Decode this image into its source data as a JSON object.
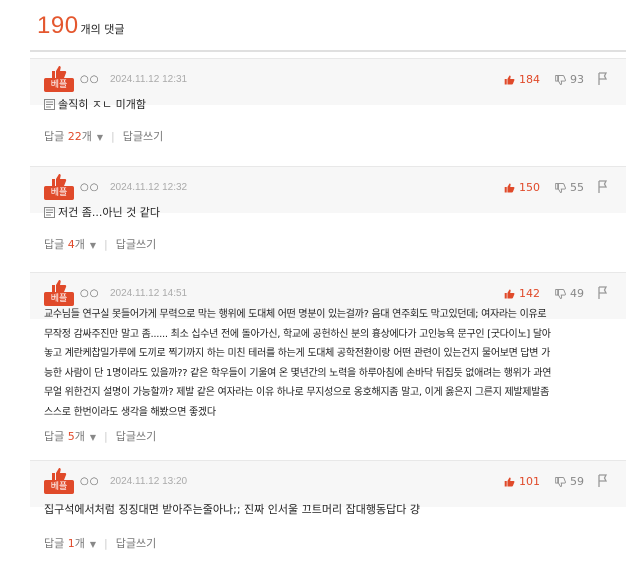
{
  "header": {
    "count": "190",
    "count_label": "개의 댓글"
  },
  "badge_label": "베플",
  "reply_write_label": "답글쓰기",
  "reply_prefix": "답글",
  "reply_suffix": "개",
  "colors": {
    "accent": "#e04a2a",
    "meta_bg": "#f7f7f7"
  },
  "comments": [
    {
      "author": "○○",
      "date": "2024.11.12 12:31",
      "likes": "184",
      "dislikes": "93",
      "text": "솔직히 ㅈㄴ 미개함",
      "has_image_mark": true,
      "reply_count": "22"
    },
    {
      "author": "○○",
      "date": "2024.11.12 12:32",
      "likes": "150",
      "dislikes": "55",
      "text": "저건 좀...아닌 것 같다",
      "has_image_mark": true,
      "reply_count": "4"
    },
    {
      "author": "○○",
      "date": "2024.11.12 14:51",
      "likes": "142",
      "dislikes": "49",
      "lines": [
        "교수님들 연구실 못들어가게 무력으로 막는 행위에 도대체 어떤 명분이 있는걸까? 음대 연주회도 막고있던데; 여자라는 이유로",
        "무작정 감싸주진만 말고 좀...... 최소 십수년 전에 돌아가신, 학교에 공헌하신 분의 흉상에다가 고인능욕 문구인 [굿다이노] 달아",
        "놓고 계란케찹밀가루에 도끼로 찍기까지 하는 미친 테러를 하는게 도대체 공학전환이랑 어떤 관련이 있는건지 물어보면 답변 가",
        "능한 사람이 단 1명이라도 있을까?? 같은 학우들이 기울여 온 몇년간의 노력을 하루아침에 손바닥 뒤집듯 없애려는 행위가 과연",
        "무얼 위한건지 설명이 가능할까? 제발 같은 여자라는 이유 하나로 무지성으로 옹호해지좀 말고, 이게 옳은지 그른지 제발제발좀",
        "스스로 한번이라도 생각을 해봤으면 좋겠다"
      ],
      "reply_count": "5"
    },
    {
      "author": "○○",
      "date": "2024.11.12 13:20",
      "likes": "101",
      "dislikes": "59",
      "text": "집구석에서처럼 징징대면 받아주는줄아나;; 진짜 인서울 끄트머리 잡대행동답다 걍",
      "has_image_mark": false,
      "reply_count": "1"
    }
  ]
}
